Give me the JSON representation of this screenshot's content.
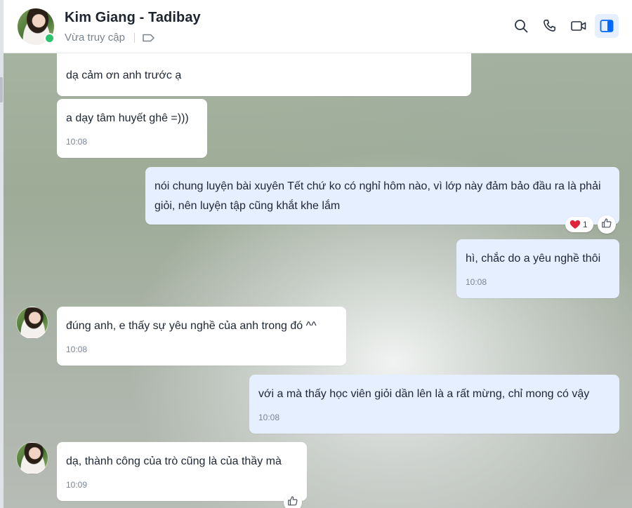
{
  "header": {
    "contact_name": "Kim Giang - Tadibay",
    "status": "Vừa truy cập",
    "icons": [
      "search-icon",
      "phone-icon",
      "video-call-icon",
      "sidebar-toggle-icon"
    ],
    "accent_color": "#0068ff",
    "online_color": "#29c46b"
  },
  "messages": [
    {
      "direction": "in",
      "text": "dạ cảm ơn anh trước ạ",
      "time": ""
    },
    {
      "direction": "in",
      "text": "a dạy tâm huyết ghê =)))",
      "time": "10:08"
    },
    {
      "direction": "out",
      "text": "nói chung luyện bài xuyên Tết chứ ko có nghỉ hôm nào, vì lớp này đảm bảo đầu ra là phải giỏi, nên luyện tập cũng khắt khe lắm",
      "time": "",
      "reaction": {
        "emoji": "❤",
        "count": "1"
      }
    },
    {
      "direction": "out",
      "text": "hì, chắc do a yêu nghề thôi",
      "time": "10:08"
    },
    {
      "direction": "in",
      "text": "đúng anh, e thấy sự yêu nghề của anh trong đó ^^",
      "time": "10:08"
    },
    {
      "direction": "out",
      "text": "với a mà thấy học viên giỏi dần lên là a rất mừng, chỉ mong có vậy",
      "time": "10:08"
    },
    {
      "direction": "in",
      "text": "dạ, thành công của trò cũng là của thầy mà",
      "time": "10:09"
    }
  ],
  "colors": {
    "incoming_bubble": "#ffffff",
    "outgoing_bubble": "#e5efff",
    "heart": "#e0243a"
  }
}
